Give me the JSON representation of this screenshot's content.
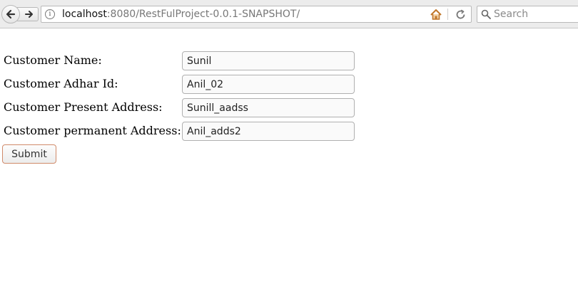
{
  "browser": {
    "url_host": "localhost",
    "url_path": ":8080/RestFulProject-0.0.1-SNAPSHOT/",
    "search_placeholder": "Search",
    "icons": {
      "back": "back-arrow-icon",
      "forward": "forward-arrow-icon",
      "info": "info-icon",
      "home": "home-icon",
      "reload": "reload-icon",
      "search": "magnifier-icon"
    },
    "info_glyph": "i"
  },
  "form": {
    "fields": [
      {
        "label": "Customer Name:",
        "value": "Sunil"
      },
      {
        "label": "Customer Adhar Id:",
        "value": "Anil_02"
      },
      {
        "label": "Customer Present Address:",
        "value": "Sunill_aadss"
      },
      {
        "label": "Customer permanent Address:",
        "value": "Anil_adds2"
      }
    ],
    "submit_label": "Submit"
  },
  "colors": {
    "toolbar_bg": "#ececec",
    "home_icon": "#c0762a",
    "submit_border": "#d08a6a"
  }
}
